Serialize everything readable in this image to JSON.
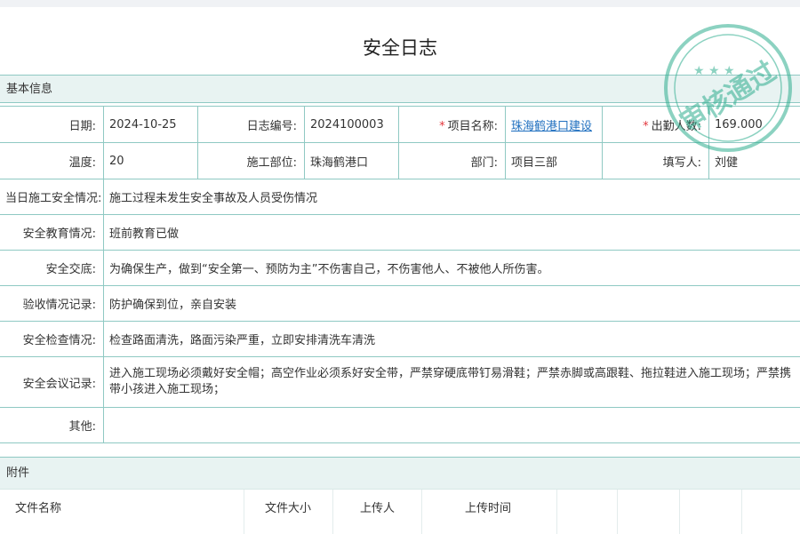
{
  "page": {
    "title": "安全日志"
  },
  "basic": {
    "header": "基本信息",
    "row1": [
      {
        "label": "日期:",
        "value": "2024-10-25"
      },
      {
        "label": "日志编号:",
        "value": "2024100003"
      },
      {
        "label": "项目名称:",
        "value": "珠海鹤港口建设",
        "required": "*"
      },
      {
        "label": "出勤人数:",
        "value": "169.000",
        "required": "*"
      }
    ],
    "row2": [
      {
        "label": "温度:",
        "value": "20"
      },
      {
        "label": "施工部位:",
        "value": "珠海鹤港口"
      },
      {
        "label": "部门:",
        "value": "项目三部"
      },
      {
        "label": "填写人:",
        "value": "刘健"
      }
    ],
    "rows": [
      {
        "label": "当日施工安全情况:",
        "value": "施工过程未发生安全事故及人员受伤情况"
      },
      {
        "label": "安全教育情况:",
        "value": "班前教育已做"
      },
      {
        "label": "安全交底:",
        "value": "为确保生产，做到“安全第一、预防为主”不伤害自己，不伤害他人、不被他人所伤害。"
      },
      {
        "label": "验收情况记录:",
        "value": "防护确保到位，亲自安装"
      },
      {
        "label": "安全检查情况:",
        "value": "检查路面清洗，路面污染严重，立即安排清洗车清洗"
      },
      {
        "label": "安全会议记录:",
        "value": "进入施工现场必须戴好安全帽；高空作业必须系好安全带，严禁穿硬底带钉易滑鞋；严禁赤脚或高跟鞋、拖拉鞋进入施工现场；严禁携带小孩进入施工现场；"
      },
      {
        "label": "其他:",
        "value": ""
      }
    ]
  },
  "attachments": {
    "header": "附件",
    "columns": [
      "文件名称",
      "文件大小",
      "上传人",
      "上传时间"
    ]
  },
  "stamp": {
    "text": "审核通过",
    "color": "#2fae8f"
  },
  "colors": {
    "border": "#8fc9c3",
    "section_bg": "#e8f3f2",
    "required": "#e2363c",
    "link": "#1f6fbf"
  }
}
